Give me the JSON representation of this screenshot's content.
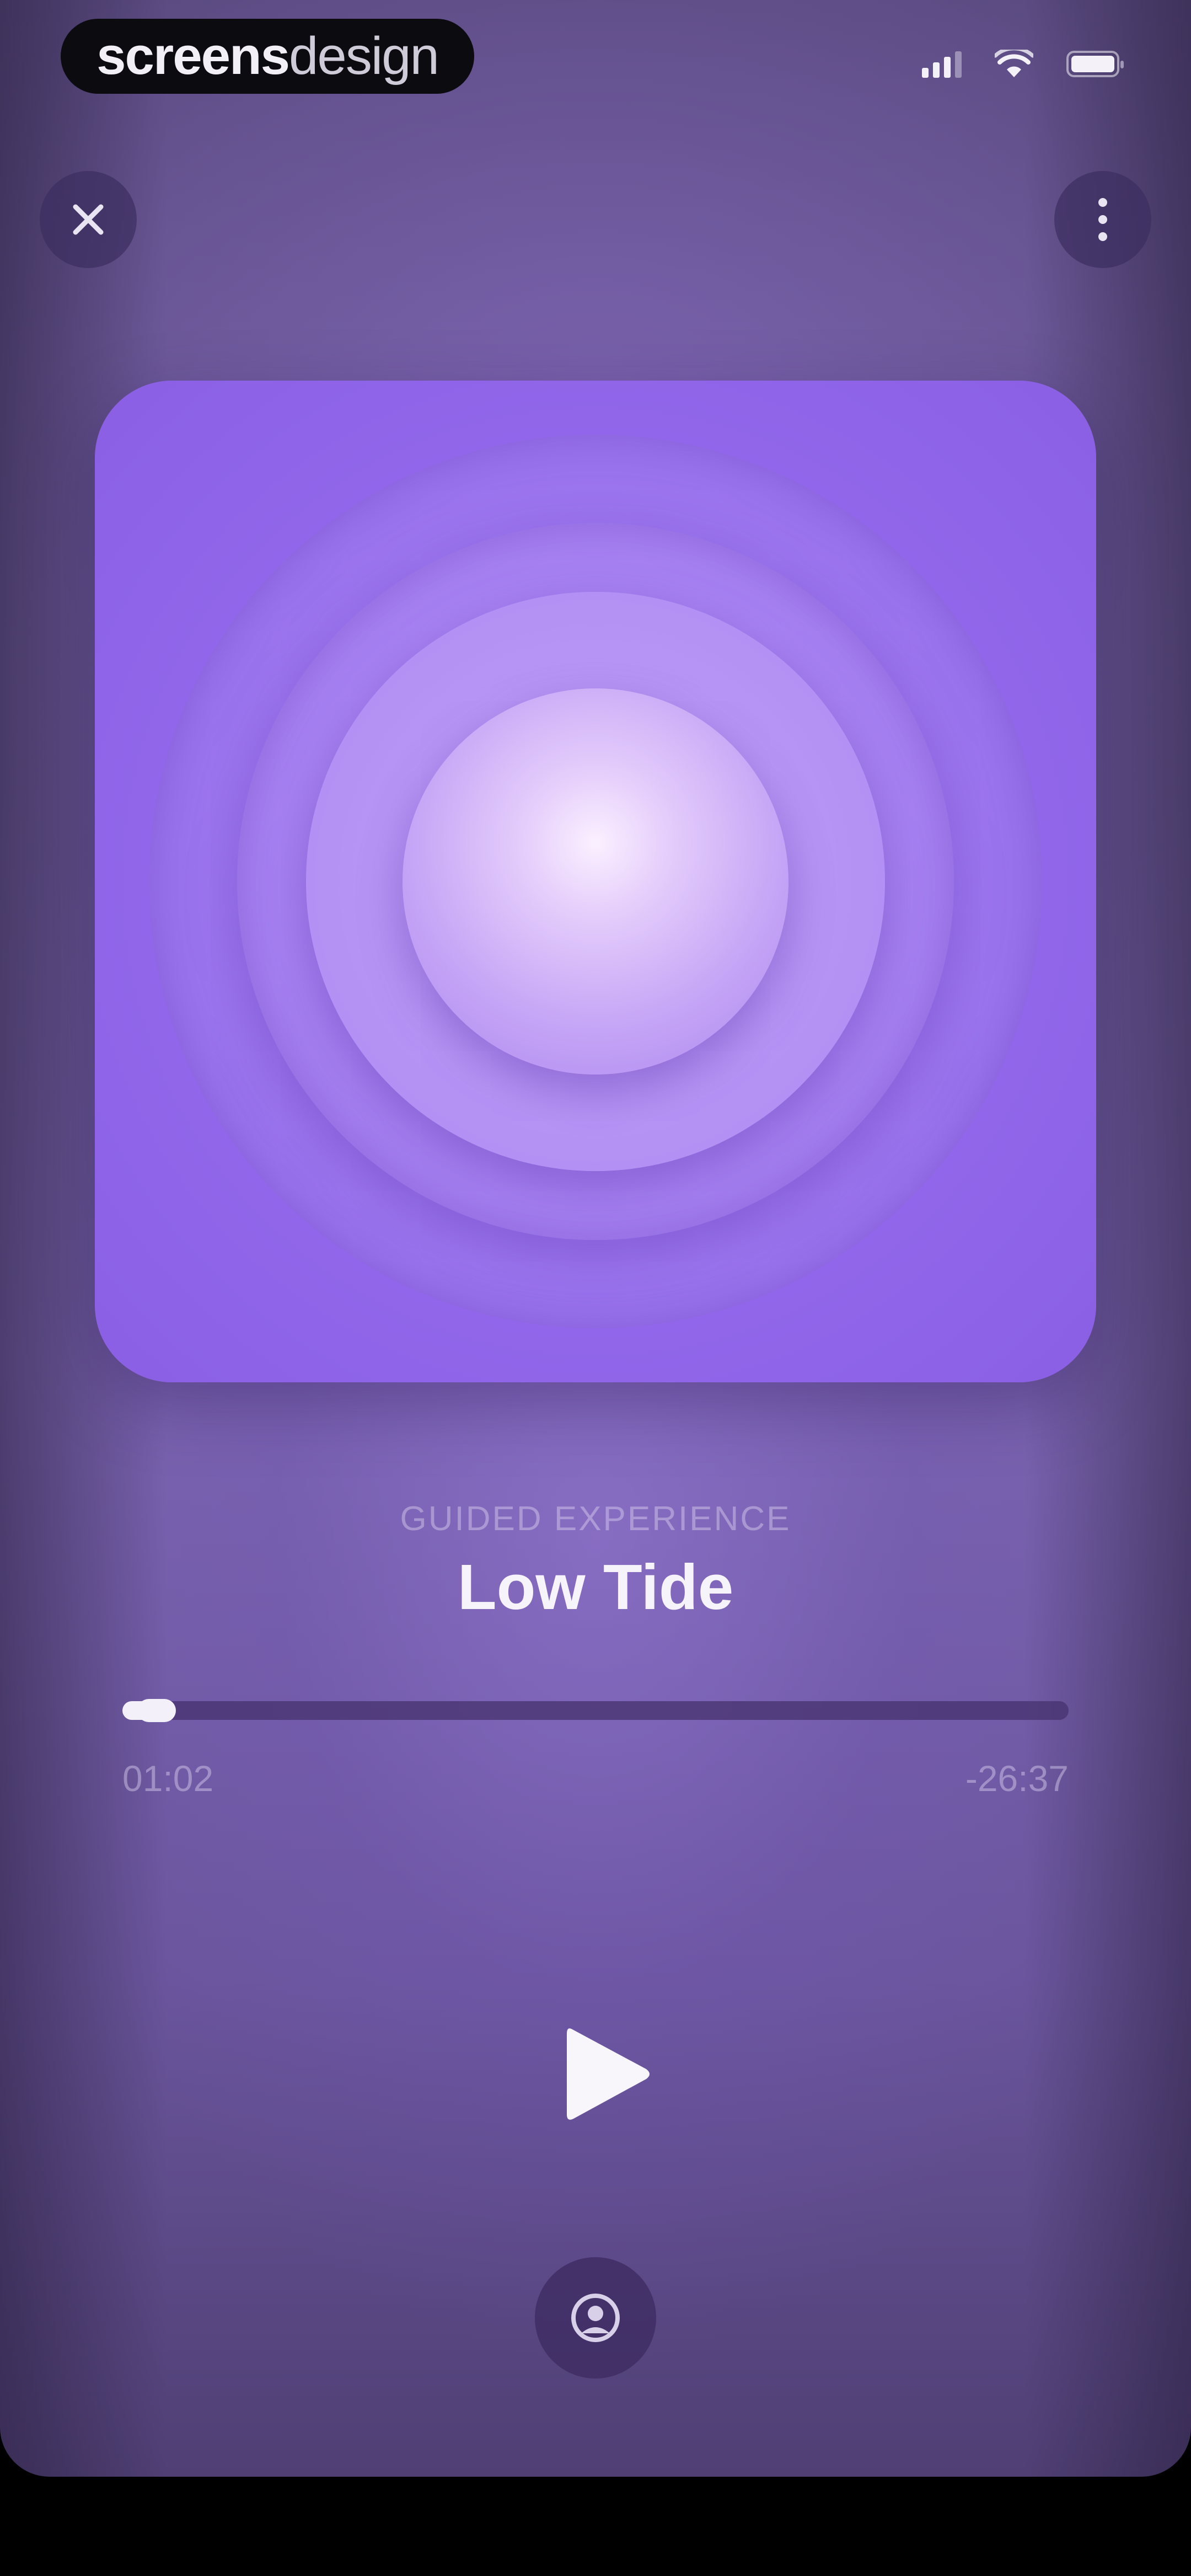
{
  "status_bar": {
    "brand_bold": "screens",
    "brand_light": "design"
  },
  "header": {
    "close_icon": "close-icon",
    "more_icon": "more-vertical-icon"
  },
  "player": {
    "category": "GUIDED EXPERIENCE",
    "title": "Low Tide",
    "elapsed": "01:02",
    "remaining": "-26:37",
    "progress_fraction": 0.036,
    "play_icon": "play-icon",
    "bottom_icon": "face-icon"
  },
  "colors": {
    "background": "#6c5a98",
    "artwork": "#9267ea",
    "text": "#f6f3fa"
  }
}
